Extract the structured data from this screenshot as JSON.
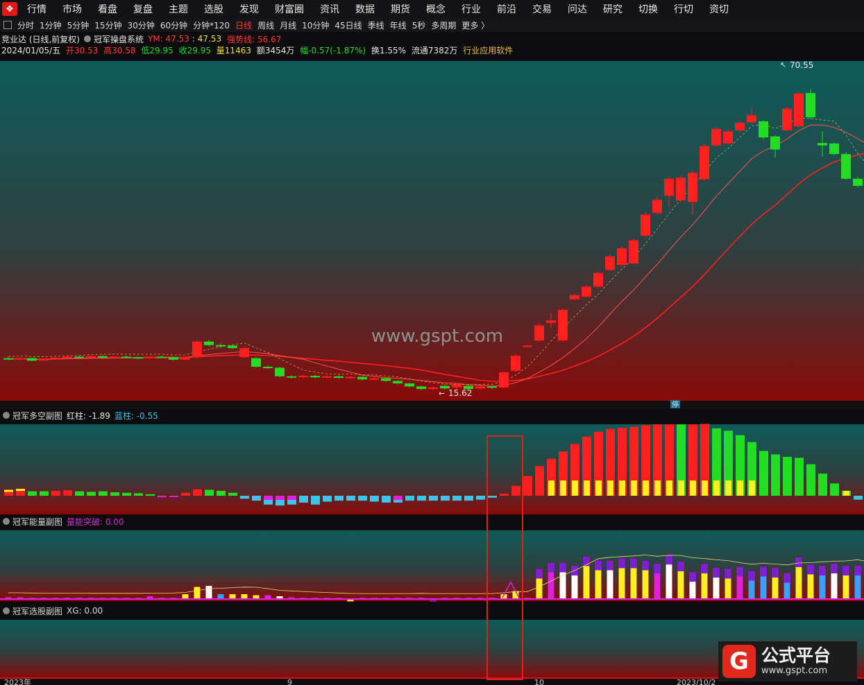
{
  "menu": [
    "行情",
    "市场",
    "看盘",
    "复盘",
    "主题",
    "选股",
    "发现",
    "财富圈",
    "资讯",
    "数据",
    "期货",
    "概念",
    "行业",
    "前沿",
    "交易",
    "问达",
    "研究",
    "切换",
    "行切",
    "资切"
  ],
  "periods": {
    "items": [
      "分时",
      "1分钟",
      "5分钟",
      "15分钟",
      "30分钟",
      "60分钟",
      "分钟*120",
      "日线",
      "周线",
      "月线",
      "10分钟",
      "45日线",
      "季线",
      "年线",
      "5秒",
      "多周期",
      "更多 〉"
    ],
    "active": "日线"
  },
  "stock": {
    "name": "竞业达 (日线,前复权)",
    "system": "冠军操盘系统",
    "ym_label": "YM: 47.53",
    "ym_value": ": 47.53",
    "strong_line": "强势线: 56.67",
    "date": "2024/01/05/五",
    "open": "开30.53",
    "high": "高30.58",
    "low": "低29.95",
    "close": "收29.95",
    "volume": "量11463",
    "amount": "额3454万",
    "change": "幅-0.57(-1.87%)",
    "turnover": "换1.55%",
    "float": "流通7382万",
    "industry": "行业应用软件"
  },
  "main_chart": {
    "high_label": "70.55",
    "low_label": "15.62",
    "watermark": "www.gspt.com",
    "badge": "停"
  },
  "sub1": {
    "title": "冠军多空副图",
    "red_label": "红柱: -1.89",
    "blue_label": "蓝柱: -0.55"
  },
  "sub2": {
    "title": "冠军能量副图",
    "energy_label": "量能突破: 0.00"
  },
  "sub3": {
    "title": "冠军选股副图",
    "xg_label": "XG: 0.00"
  },
  "axis": {
    "labels": [
      "2023年",
      "9",
      "10",
      "2023/10/2"
    ]
  },
  "brand": {
    "name": "公式平台",
    "url": "www.gspt.com"
  },
  "colors": {
    "up": "#ff1f1f",
    "down": "#22dd22",
    "accent_red": "#ff3b3b",
    "cyan": "#3ec3ea",
    "magenta": "#e020e0",
    "yellow": "#ffee20"
  },
  "candles": [
    {
      "o": 22,
      "c": 21.8,
      "h": 22.2,
      "l": 21.6
    },
    {
      "o": 21.8,
      "c": 22,
      "h": 22.1,
      "l": 21.6
    },
    {
      "o": 22,
      "c": 21.5,
      "h": 22.1,
      "l": 21.4
    },
    {
      "o": 21.6,
      "c": 21.8,
      "h": 22,
      "l": 21.5
    },
    {
      "o": 21.8,
      "c": 22.1,
      "h": 22.3,
      "l": 21.7
    },
    {
      "o": 22.1,
      "c": 22.3,
      "h": 22.5,
      "l": 22
    },
    {
      "o": 22.3,
      "c": 22.2,
      "h": 22.5,
      "l": 22
    },
    {
      "o": 22.2,
      "c": 22.4,
      "h": 22.6,
      "l": 22.1
    },
    {
      "o": 22.4,
      "c": 22.1,
      "h": 22.6,
      "l": 22
    },
    {
      "o": 22.1,
      "c": 22.3,
      "h": 22.4,
      "l": 21.9
    },
    {
      "o": 22.3,
      "c": 22.2,
      "h": 22.5,
      "l": 22
    },
    {
      "o": 22.2,
      "c": 22.1,
      "h": 22.3,
      "l": 21.9
    },
    {
      "o": 22.1,
      "c": 22.3,
      "h": 22.4,
      "l": 21.9
    },
    {
      "o": 22.3,
      "c": 22.2,
      "h": 22.5,
      "l": 22
    },
    {
      "o": 22.2,
      "c": 21.7,
      "h": 22.3,
      "l": 21.5
    },
    {
      "o": 21.7,
      "c": 22.2,
      "h": 22.4,
      "l": 21.6
    },
    {
      "o": 22.2,
      "c": 25.3,
      "h": 25.6,
      "l": 22
    },
    {
      "o": 25.3,
      "c": 24.6,
      "h": 25.6,
      "l": 24.4
    },
    {
      "o": 24.6,
      "c": 24.5,
      "h": 24.9,
      "l": 24.2
    },
    {
      "o": 24.5,
      "c": 24,
      "h": 24.7,
      "l": 23.8
    },
    {
      "o": 22.2,
      "c": 24,
      "h": 24.2,
      "l": 22
    },
    {
      "o": 22,
      "c": 20.3,
      "h": 22.2,
      "l": 20.1
    },
    {
      "o": 20.3,
      "c": 20.1,
      "h": 20.5,
      "l": 19.9
    },
    {
      "o": 20.1,
      "c": 18.4,
      "h": 20.3,
      "l": 18.2
    },
    {
      "o": 18.4,
      "c": 18.2,
      "h": 18.6,
      "l": 18
    },
    {
      "o": 18.3,
      "c": 18.5,
      "h": 18.7,
      "l": 18.1
    },
    {
      "o": 18.5,
      "c": 18.2,
      "h": 18.7,
      "l": 18
    },
    {
      "o": 18.2,
      "c": 18.4,
      "h": 18.6,
      "l": 18
    },
    {
      "o": 18.4,
      "c": 18.1,
      "h": 18.6,
      "l": 17.9
    },
    {
      "o": 18.1,
      "c": 18.3,
      "h": 18.5,
      "l": 17.9
    },
    {
      "o": 18.3,
      "c": 17.8,
      "h": 18.4,
      "l": 17.6
    },
    {
      "o": 17.8,
      "c": 18,
      "h": 18.2,
      "l": 17.6
    },
    {
      "o": 18,
      "c": 17.5,
      "h": 18.1,
      "l": 17.3
    },
    {
      "o": 17.5,
      "c": 17,
      "h": 17.6,
      "l": 16.8
    },
    {
      "o": 17,
      "c": 16.4,
      "h": 17.1,
      "l": 16.2
    },
    {
      "o": 16.4,
      "c": 15.9,
      "h": 16.5,
      "l": 15.7
    },
    {
      "o": 15.9,
      "c": 16.2,
      "h": 16.4,
      "l": 15.7
    },
    {
      "o": 16.5,
      "c": 16,
      "h": 16.8,
      "l": 15.8
    },
    {
      "o": 16.2,
      "c": 16.8,
      "h": 17,
      "l": 15.9
    },
    {
      "o": 16.5,
      "c": 15.9,
      "h": 16.9,
      "l": 15.62
    },
    {
      "o": 16,
      "c": 16.4,
      "h": 16.6,
      "l": 15.8
    },
    {
      "o": 16.4,
      "c": 16.2,
      "h": 16.6,
      "l": 15.9
    },
    {
      "o": 16.2,
      "c": 19.2,
      "h": 19.4,
      "l": 16
    },
    {
      "o": 19.5,
      "c": 22.5,
      "h": 22.8,
      "l": 19.3
    },
    {
      "o": 24.5,
      "c": 24.5,
      "h": 24.6,
      "l": 24.4
    },
    {
      "o": 25.5,
      "c": 28.5,
      "h": 28.8,
      "l": 25.3
    },
    {
      "o": 29,
      "c": 29.5,
      "h": 31,
      "l": 28
    },
    {
      "o": 25.5,
      "c": 31.6,
      "h": 31.9,
      "l": 25.3
    },
    {
      "o": 33.7,
      "c": 34.5,
      "h": 34.8,
      "l": 33.5
    },
    {
      "o": 34.2,
      "c": 36.2,
      "h": 36.6,
      "l": 34
    },
    {
      "o": 36.2,
      "c": 38.9,
      "h": 39.2,
      "l": 36
    },
    {
      "o": 39.5,
      "c": 42.2,
      "h": 42.6,
      "l": 39.3
    },
    {
      "o": 40.5,
      "c": 43.8,
      "h": 44.2,
      "l": 40.3
    },
    {
      "o": 40.8,
      "c": 45.4,
      "h": 45.8,
      "l": 40.6
    },
    {
      "o": 46.3,
      "c": 50.5,
      "h": 51,
      "l": 46
    },
    {
      "o": 50.8,
      "c": 53.4,
      "h": 54,
      "l": 50.6
    },
    {
      "o": 54.2,
      "c": 57.6,
      "h": 58,
      "l": 52
    },
    {
      "o": 53.3,
      "c": 57.8,
      "h": 58.2,
      "l": 53
    },
    {
      "o": 53,
      "c": 58.8,
      "h": 59.2,
      "l": 50.4
    },
    {
      "o": 57.5,
      "c": 64.1,
      "h": 64.5,
      "l": 57.3
    },
    {
      "o": 64.2,
      "c": 67.5,
      "h": 67.9,
      "l": 64
    },
    {
      "o": 64.6,
      "c": 67,
      "h": 67.4,
      "l": 64.4
    },
    {
      "o": 67.2,
      "c": 68.7,
      "h": 69,
      "l": 66.8
    },
    {
      "o": 68.8,
      "c": 70.2,
      "h": 71.5,
      "l": 68.5
    },
    {
      "o": 69,
      "c": 65.8,
      "h": 69.2,
      "l": 65.5
    },
    {
      "o": 66,
      "c": 63.4,
      "h": 66.2,
      "l": 61.8
    },
    {
      "o": 67.2,
      "c": 71.5,
      "h": 71.9,
      "l": 67
    },
    {
      "o": 68,
      "c": 74.5,
      "h": 74.9,
      "l": 67.8
    },
    {
      "o": 74.6,
      "c": 69.8,
      "h": 75.4,
      "l": 69.5
    },
    {
      "o": 64.7,
      "c": 64.2,
      "h": 67,
      "l": 62
    },
    {
      "o": 64.6,
      "c": 62.5,
      "h": 64.8,
      "l": 62.2
    },
    {
      "o": 62.5,
      "c": 57.6,
      "h": 62.9,
      "l": 57.4
    },
    {
      "o": 57.6,
      "c": 56.2,
      "h": 57.9,
      "l": 55.9
    },
    {
      "o": 56.4,
      "c": 55.6,
      "h": 56.6,
      "l": 55.3
    },
    {
      "o": 56,
      "c": 55.5,
      "h": 56.3,
      "l": 55.2
    },
    {
      "o": 55.5,
      "c": 56.6,
      "h": 58.5,
      "l": 55.2
    }
  ],
  "sub1_bars": [
    {
      "v": 1.2,
      "c": "yr"
    },
    {
      "v": 1.4,
      "c": "yr"
    },
    {
      "v": 0.9,
      "c": "g"
    },
    {
      "v": 0.9,
      "c": "g"
    },
    {
      "v": 1,
      "c": "r"
    },
    {
      "v": 1.1,
      "c": "r"
    },
    {
      "v": 0.9,
      "c": "g"
    },
    {
      "v": 0.8,
      "c": "g"
    },
    {
      "v": 0.9,
      "c": "g"
    },
    {
      "v": 0.7,
      "c": "g"
    },
    {
      "v": 0.6,
      "c": "g"
    },
    {
      "v": 0.5,
      "c": "g"
    },
    {
      "v": 0.3,
      "c": "g"
    },
    {
      "v": -0.3,
      "c": "m"
    },
    {
      "v": -0.2,
      "c": "m"
    },
    {
      "v": 0.6,
      "c": "r"
    },
    {
      "v": 1.3,
      "c": "r"
    },
    {
      "v": 1.2,
      "c": "g"
    },
    {
      "v": 1,
      "c": "g"
    },
    {
      "v": 0.6,
      "c": "g"
    },
    {
      "v": -0.6,
      "c": "c"
    },
    {
      "v": -1,
      "c": "c"
    },
    {
      "v": -1.8,
      "c": "cm"
    },
    {
      "v": -2,
      "c": "cm"
    },
    {
      "v": -1.8,
      "c": "cm"
    },
    {
      "v": -1.4,
      "c": "c"
    },
    {
      "v": -1.8,
      "c": "c"
    },
    {
      "v": -1.2,
      "c": "c"
    },
    {
      "v": -1,
      "c": "c"
    },
    {
      "v": -1,
      "c": "c"
    },
    {
      "v": -1,
      "c": "c"
    },
    {
      "v": -1.2,
      "c": "c"
    },
    {
      "v": -1.4,
      "c": "c"
    },
    {
      "v": -1.4,
      "c": "cm"
    },
    {
      "v": -1,
      "c": "c"
    },
    {
      "v": -1,
      "c": "c"
    },
    {
      "v": -1,
      "c": "c"
    },
    {
      "v": -1,
      "c": "c"
    },
    {
      "v": -1,
      "c": "c"
    },
    {
      "v": -1,
      "c": "c"
    },
    {
      "v": -0.8,
      "c": "c"
    },
    {
      "v": -0.4,
      "c": "c"
    },
    {
      "v": 0.4,
      "c": "r"
    },
    {
      "v": 2,
      "c": "r"
    },
    {
      "v": 4,
      "c": "r"
    },
    {
      "v": 6,
      "c": "r"
    },
    {
      "v": 7.5,
      "c": "ry"
    },
    {
      "v": 9,
      "c": "ry"
    },
    {
      "v": 10.5,
      "c": "ry"
    },
    {
      "v": 12,
      "c": "ry"
    },
    {
      "v": 13,
      "c": "ry"
    },
    {
      "v": 13.6,
      "c": "ry"
    },
    {
      "v": 13.8,
      "c": "ry"
    },
    {
      "v": 14,
      "c": "ry"
    },
    {
      "v": 14.3,
      "c": "ry"
    },
    {
      "v": 14.5,
      "c": "ry"
    },
    {
      "v": 14.5,
      "c": "ry"
    },
    {
      "v": 14.5,
      "c": "gy"
    },
    {
      "v": 14.5,
      "c": "ry"
    },
    {
      "v": 14.6,
      "c": "ry"
    },
    {
      "v": 13.7,
      "c": "gy"
    },
    {
      "v": 13.2,
      "c": "gy"
    },
    {
      "v": 12.3,
      "c": "gy"
    },
    {
      "v": 10.9,
      "c": "gy"
    },
    {
      "v": 9.1,
      "c": "g"
    },
    {
      "v": 8.4,
      "c": "g"
    },
    {
      "v": 7.9,
      "c": "g"
    },
    {
      "v": 7.7,
      "c": "g"
    },
    {
      "v": 6.4,
      "c": "g"
    },
    {
      "v": 4.5,
      "c": "g"
    },
    {
      "v": 2.5,
      "c": "g"
    },
    {
      "v": 1,
      "c": "gy"
    },
    {
      "v": -0.8,
      "c": "c"
    },
    {
      "v": -1.5,
      "c": "cm"
    },
    {
      "v": -2.2,
      "c": "cm"
    },
    {
      "v": -2.4,
      "c": "cm"
    },
    {
      "v": -2.6,
      "c": "cm"
    }
  ],
  "sub2_bars": [
    {
      "h": 0.4,
      "c": "m"
    },
    {
      "h": 0.4,
      "c": "m"
    },
    {
      "h": 0.3,
      "c": "m"
    },
    {
      "h": 0.3,
      "c": "m"
    },
    {
      "h": 0.3,
      "c": "m"
    },
    {
      "h": 0.3,
      "c": "m"
    },
    {
      "h": 0.3,
      "c": "m"
    },
    {
      "h": 0.3,
      "c": "m"
    },
    {
      "h": 0.3,
      "c": "m"
    },
    {
      "h": 0.3,
      "c": "m"
    },
    {
      "h": 0.3,
      "c": "m"
    },
    {
      "h": 0.3,
      "c": "m"
    },
    {
      "h": 0.6,
      "c": "m"
    },
    {
      "h": 0.3,
      "c": "m"
    },
    {
      "h": 0.3,
      "c": "m"
    },
    {
      "h": 1,
      "c": "y"
    },
    {
      "h": 2.4,
      "c": "y"
    },
    {
      "h": 2.6,
      "c": "wc"
    },
    {
      "h": 1,
      "c": "b"
    },
    {
      "h": 1,
      "c": "y"
    },
    {
      "h": 1,
      "c": "y"
    },
    {
      "h": 0.8,
      "c": "y"
    },
    {
      "h": 0.8,
      "c": "m"
    },
    {
      "h": 0.6,
      "c": "w"
    },
    {
      "h": 0.4,
      "c": "m"
    },
    {
      "h": 0.3,
      "c": "m"
    },
    {
      "h": 0.3,
      "c": "m"
    },
    {
      "h": 0.3,
      "c": "m"
    },
    {
      "h": 0.3,
      "c": "m"
    },
    {
      "h": -0.5,
      "c": "y"
    },
    {
      "h": 0.3,
      "c": "m"
    },
    {
      "h": 0.3,
      "c": "m"
    },
    {
      "h": 0.3,
      "c": "m"
    },
    {
      "h": 0.3,
      "c": "m"
    },
    {
      "h": 0.3,
      "c": "m"
    },
    {
      "h": 0.3,
      "c": "m"
    },
    {
      "h": -0.5,
      "c": "p"
    },
    {
      "h": 0.3,
      "c": "m"
    },
    {
      "h": 0.3,
      "c": "m"
    },
    {
      "h": 0.3,
      "c": "m"
    },
    {
      "h": 0.3,
      "c": "m"
    },
    {
      "h": 0.3,
      "c": "m"
    },
    {
      "h": 1,
      "c": "y"
    },
    {
      "h": 1.6,
      "c": "y"
    },
    {
      "h": 0.3,
      "c": "m"
    },
    {
      "h": 5.8,
      "c": "y"
    },
    {
      "h": 7,
      "c": "m"
    },
    {
      "h": 7,
      "c": "w"
    },
    {
      "h": 6.4,
      "c": "w"
    },
    {
      "h": 8.2,
      "c": "y"
    },
    {
      "h": 7.4,
      "c": "y"
    },
    {
      "h": 7.4,
      "c": "w"
    },
    {
      "h": 7.8,
      "c": "y"
    },
    {
      "h": 7.8,
      "c": "y"
    },
    {
      "h": 7.4,
      "c": "y"
    },
    {
      "h": 6.8,
      "c": "m"
    },
    {
      "h": 8.5,
      "c": "w"
    },
    {
      "h": 7.2,
      "c": "y"
    },
    {
      "h": 5.2,
      "c": "w"
    },
    {
      "h": 6.8,
      "c": "y"
    },
    {
      "h": 6,
      "c": "w"
    },
    {
      "h": 5.8,
      "c": "y"
    },
    {
      "h": 6.2,
      "c": "m"
    },
    {
      "h": 5.4,
      "c": "b"
    },
    {
      "h": 6.2,
      "c": "b"
    },
    {
      "h": 6,
      "c": "y"
    },
    {
      "h": 5,
      "c": "b"
    },
    {
      "h": 8,
      "c": "y"
    },
    {
      "h": 6.6,
      "c": "y"
    },
    {
      "h": 6.4,
      "c": "b"
    },
    {
      "h": 6.8,
      "c": "w"
    },
    {
      "h": 6.4,
      "c": "y"
    },
    {
      "h": 6.4,
      "c": "b"
    },
    {
      "h": 5.2,
      "c": "y"
    },
    {
      "h": 4.4,
      "c": "y"
    },
    {
      "h": 3,
      "c": "b"
    },
    {
      "h": 2.8,
      "c": "y"
    },
    {
      "h": 4.8,
      "c": "y"
    }
  ]
}
